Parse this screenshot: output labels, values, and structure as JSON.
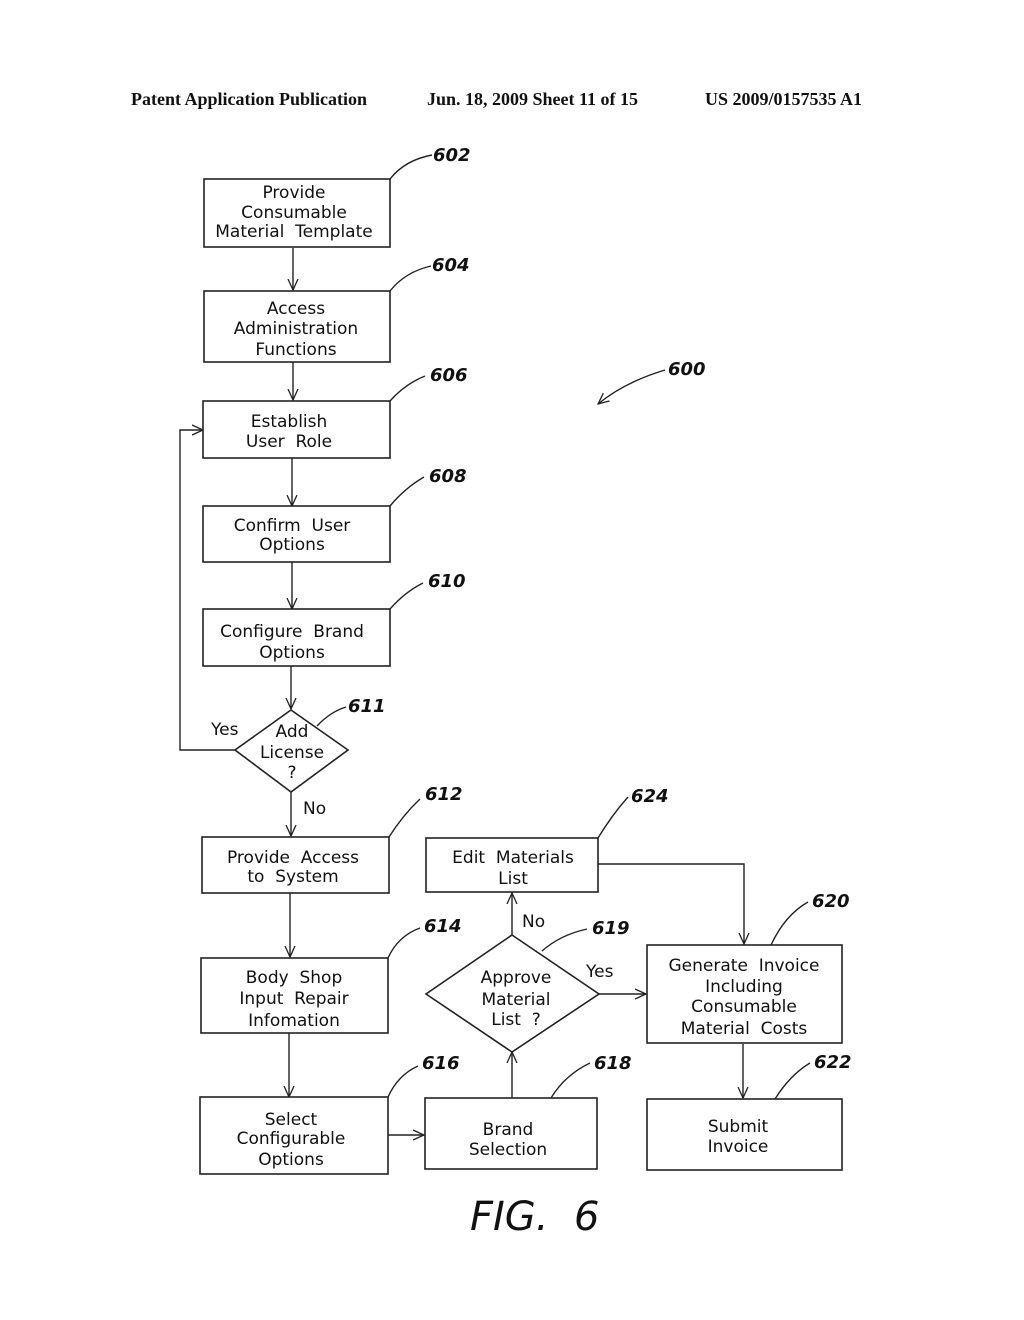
{
  "header": {
    "publication": "Patent Application Publication",
    "date_sheet": "Jun. 18, 2009  Sheet 11 of 15",
    "number": "US 2009/0157535 A1"
  },
  "diagram_ref": "600",
  "figure_label": "FIG.  6",
  "nodes": {
    "n602": {
      "ref": "602",
      "lines": [
        "Provide",
        "Consumable",
        "Material  Template"
      ]
    },
    "n604": {
      "ref": "604",
      "lines": [
        "Access",
        "Administration",
        "Functions"
      ]
    },
    "n606": {
      "ref": "606",
      "lines": [
        "Establish",
        "User  Role"
      ]
    },
    "n608": {
      "ref": "608",
      "lines": [
        "Confirm  User",
        "Options"
      ]
    },
    "n610": {
      "ref": "610",
      "lines": [
        "Configure  Brand",
        "Options"
      ]
    },
    "n611": {
      "ref": "611",
      "lines": [
        "Add",
        "License",
        "?"
      ]
    },
    "n612": {
      "ref": "612",
      "lines": [
        "Provide  Access",
        "to  System"
      ]
    },
    "n614": {
      "ref": "614",
      "lines": [
        "Body  Shop",
        "Input  Repair",
        "Infomation"
      ]
    },
    "n616": {
      "ref": "616",
      "lines": [
        "Select",
        "Configurable",
        "Options"
      ]
    },
    "n618": {
      "ref": "618",
      "lines": [
        "Brand",
        "Selection"
      ]
    },
    "n619": {
      "ref": "619",
      "lines": [
        "Approve",
        "Material",
        "List  ?"
      ]
    },
    "n620": {
      "ref": "620",
      "lines": [
        "Generate  Invoice",
        "Including",
        "Consumable",
        "Material  Costs"
      ]
    },
    "n622": {
      "ref": "622",
      "lines": [
        "Submit",
        "Invoice"
      ]
    },
    "n624": {
      "ref": "624",
      "lines": [
        "Edit  Materials",
        "List"
      ]
    }
  },
  "edge_labels": {
    "e611_yes": "Yes",
    "e611_no": "No",
    "e619_no": "No",
    "e619_yes": "Yes"
  }
}
